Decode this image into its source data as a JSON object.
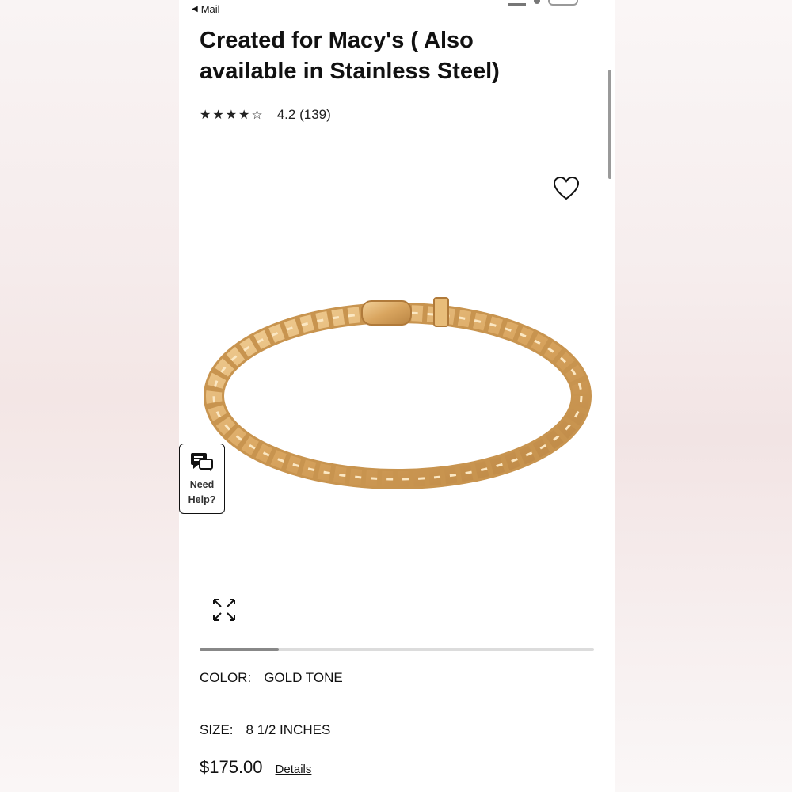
{
  "status_bar": {
    "back_label": "Mail"
  },
  "product": {
    "title": "Created for Macy's ( Also available in Stainless Steel)",
    "stars": "★★★★☆",
    "rating_value": "4.2",
    "rating_count": "139",
    "image_icon": "gold-cuban-link-bracelet"
  },
  "help_widget": {
    "icon": "chat-bubbles-icon",
    "label": "Need Help?"
  },
  "gallery": {
    "progress_fraction": 0.2
  },
  "options": {
    "color_label": "COLOR:",
    "color_value": "GOLD TONE",
    "size_label": "SIZE:",
    "size_value": "8 1/2 INCHES"
  },
  "pricing": {
    "price": "$175.00",
    "details_link": "Details"
  },
  "colors": {
    "accent_gold": "#d9a55f",
    "text": "#111111"
  }
}
